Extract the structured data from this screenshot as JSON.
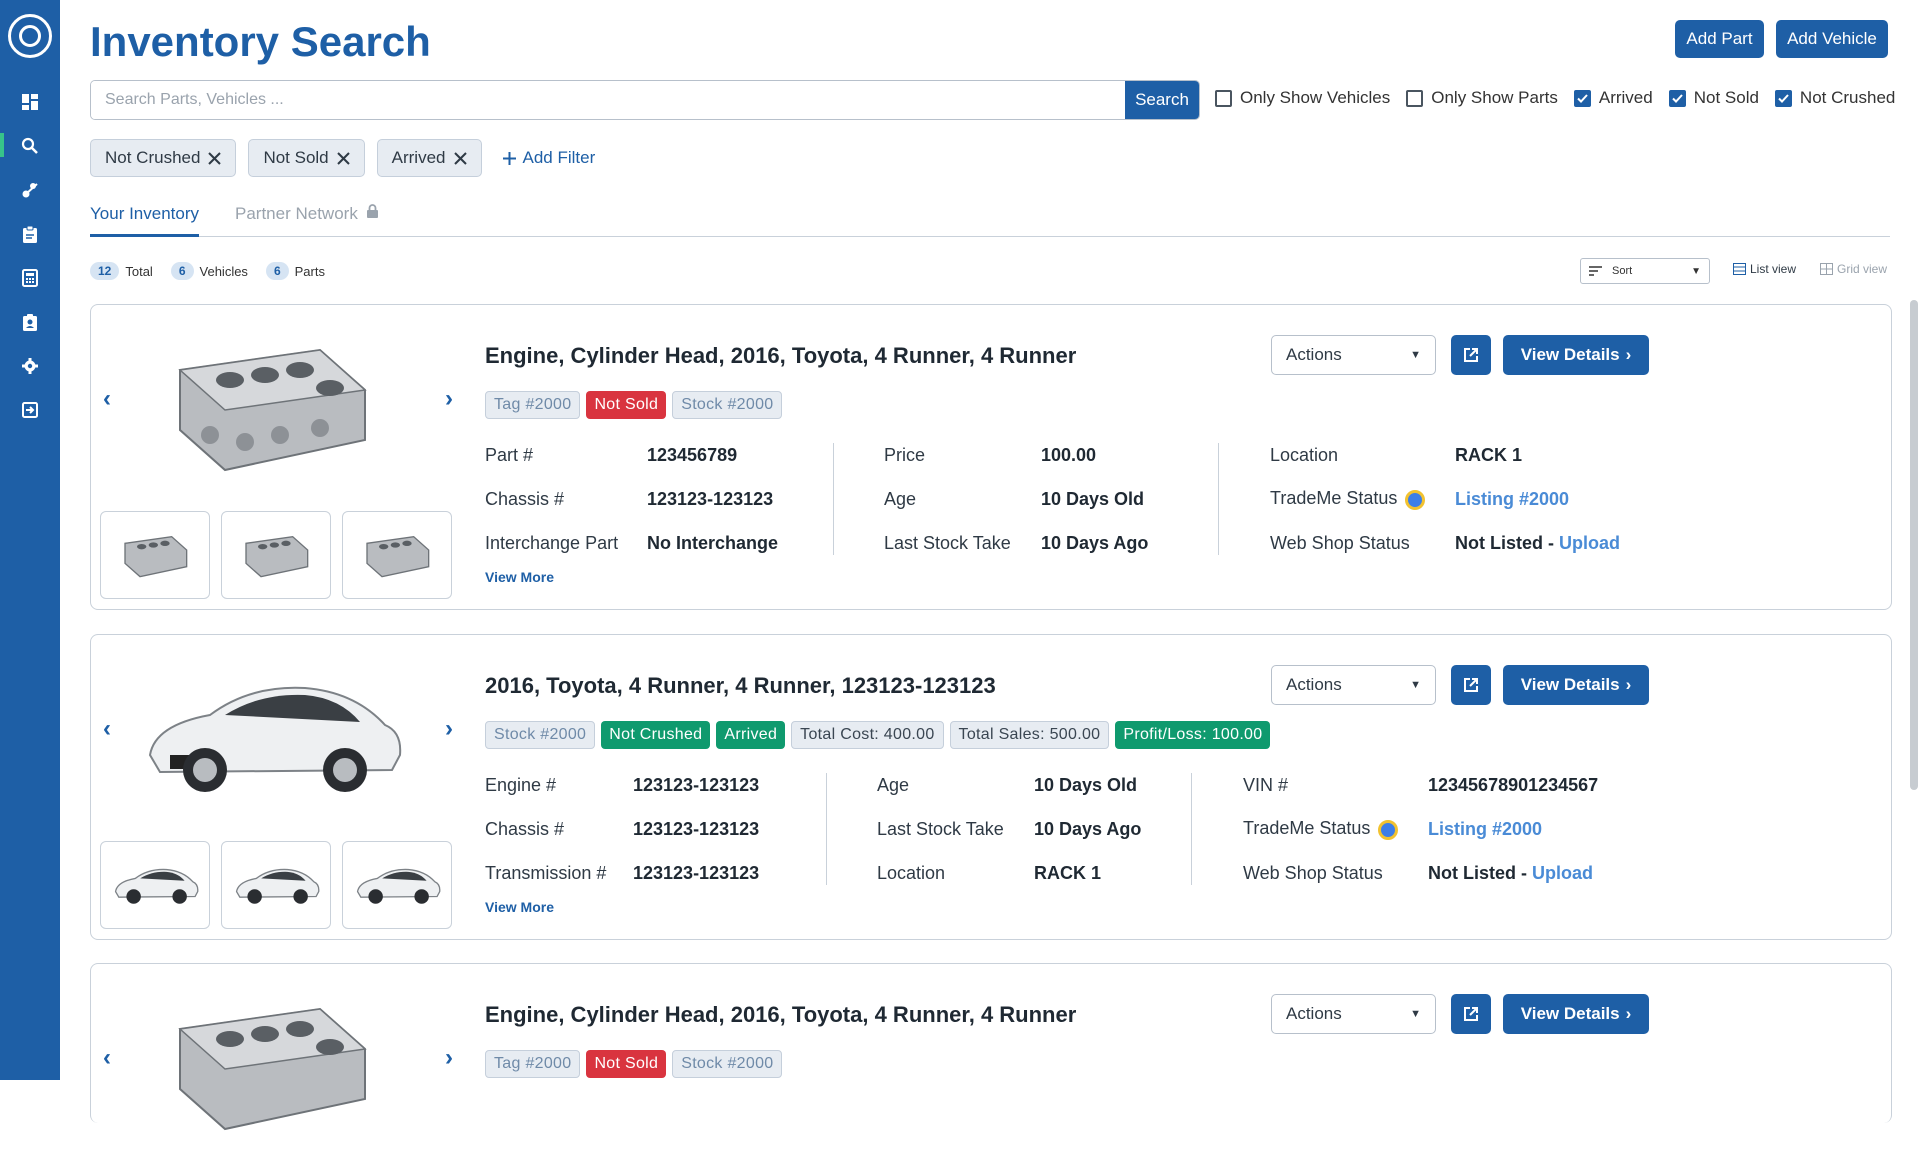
{
  "page": {
    "title": "Inventory Search",
    "add_part_label": "Add Part",
    "add_vehicle_label": "Add Vehicle"
  },
  "search": {
    "placeholder": "Search Parts, Vehicles ...",
    "value": "",
    "button_label": "Search"
  },
  "checkboxes": [
    {
      "label": "Only Show Vehicles",
      "checked": false
    },
    {
      "label": "Only Show Parts",
      "checked": false
    },
    {
      "label": "Arrived",
      "checked": true
    },
    {
      "label": "Not Sold",
      "checked": true
    },
    {
      "label": "Not Crushed",
      "checked": true
    }
  ],
  "filters": [
    "Not Crushed",
    "Not Sold",
    "Arrived"
  ],
  "add_filter_label": "Add Filter",
  "tabs": [
    {
      "label": "Your Inventory",
      "active": true
    },
    {
      "label": "Partner Network",
      "active": false,
      "locked": true
    }
  ],
  "counts": [
    {
      "value": "12",
      "label": "Total"
    },
    {
      "value": "6",
      "label": "Vehicles"
    },
    {
      "value": "6",
      "label": "Parts"
    }
  ],
  "sort_label": "Sort",
  "views": {
    "list": "List view",
    "grid": "Grid view"
  },
  "actions_label": "Actions",
  "view_details_label": "View Details",
  "view_more_label": "View More",
  "cards": [
    {
      "title": "Engine, Cylinder Head, 2016, Toyota, 4 Runner, 4 Runner",
      "image": "engine-block",
      "badges": [
        {
          "text": "Tag #2000",
          "style": "gray"
        },
        {
          "text": "Not Sold",
          "style": "red"
        },
        {
          "text": "Stock #2000",
          "style": "gray"
        }
      ],
      "col1": [
        {
          "k": "Part #",
          "v": "123456789"
        },
        {
          "k": "Chassis #",
          "v": "123123-123123"
        },
        {
          "k": "Interchange Part",
          "v": "No Interchange"
        }
      ],
      "col2": [
        {
          "k": "Price",
          "v": "100.00"
        },
        {
          "k": "Age",
          "v": "10 Days Old"
        },
        {
          "k": "Last Stock Take",
          "v": "10 Days Ago"
        }
      ],
      "col3": [
        {
          "k": "Location",
          "v": "RACK 1"
        },
        {
          "k": "TradeMe Status",
          "v": "Listing #2000"
        },
        {
          "k": "Web Shop Status",
          "v": "Not Listed",
          "sep": " - ",
          "link": "Upload"
        }
      ]
    },
    {
      "title": "2016, Toyota, 4 Runner, 4 Runner, 123123-123123",
      "image": "car",
      "badges": [
        {
          "text": "Stock #2000",
          "style": "gray"
        },
        {
          "text": "Not Crushed",
          "style": "green"
        },
        {
          "text": "Arrived",
          "style": "green"
        },
        {
          "text": "Total Cost: 400.00",
          "style": "gray-dark"
        },
        {
          "text": "Total Sales: 500.00",
          "style": "gray-dark"
        },
        {
          "text": "Profit/Loss: 100.00",
          "style": "green"
        }
      ],
      "col1": [
        {
          "k": "Engine #",
          "v": "123123-123123"
        },
        {
          "k": "Chassis #",
          "v": "123123-123123"
        },
        {
          "k": "Transmission #",
          "v": "123123-123123"
        }
      ],
      "col2": [
        {
          "k": "Age",
          "v": "10 Days Old"
        },
        {
          "k": "Last Stock Take",
          "v": "10 Days Ago"
        },
        {
          "k": "Location",
          "v": "RACK 1"
        }
      ],
      "col3": [
        {
          "k": "VIN #",
          "v": "12345678901234567"
        },
        {
          "k": "TradeMe Status",
          "v": "Listing #2000"
        },
        {
          "k": "Web Shop Status",
          "v": "Not Listed",
          "sep": " - ",
          "link": "Upload"
        }
      ]
    },
    {
      "title": "Engine, Cylinder Head, 2016, Toyota, 4 Runner, 4 Runner",
      "image": "engine-block",
      "badges": [
        {
          "text": "Tag #2000",
          "style": "gray"
        },
        {
          "text": "Not Sold",
          "style": "red"
        },
        {
          "text": "Stock #2000",
          "style": "gray"
        }
      ]
    }
  ],
  "colors": {
    "primary": "#1e5fa6",
    "danger": "#d9343f",
    "success": "#0f9a6e",
    "link": "#4a8bd6"
  }
}
